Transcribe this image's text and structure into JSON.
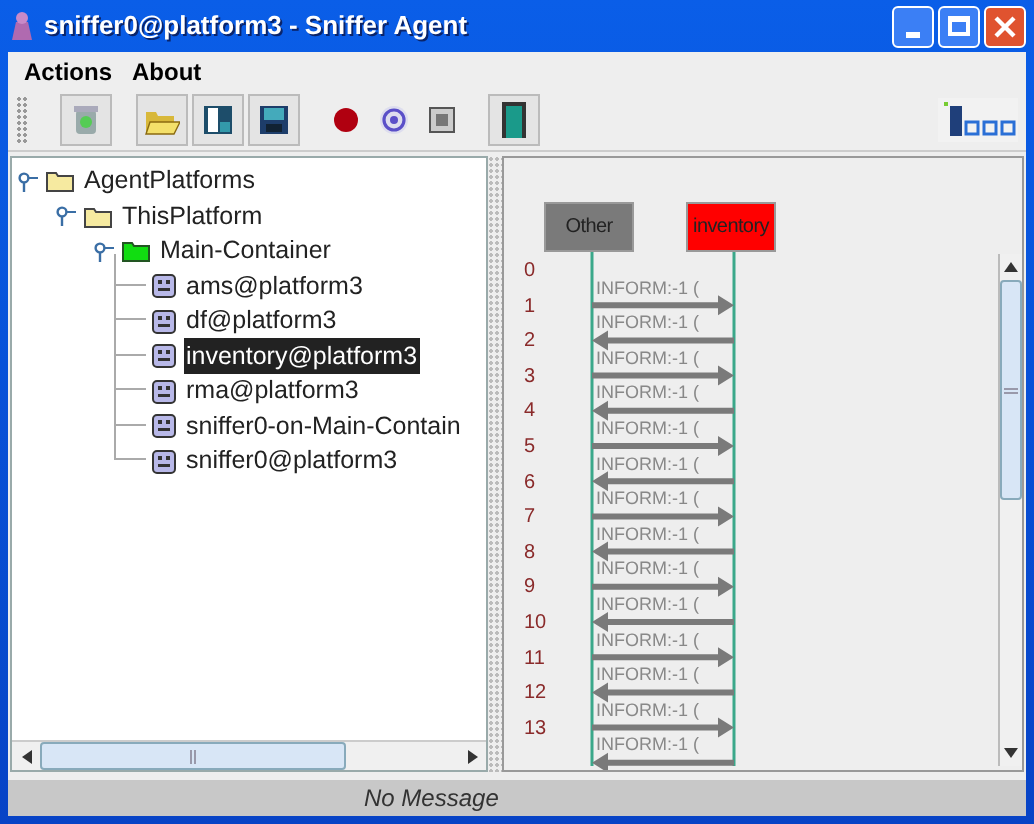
{
  "window": {
    "title": "sniffer0@platform3 - Sniffer Agent"
  },
  "menu": [
    "Actions",
    "About"
  ],
  "tree": [
    {
      "label": "AgentPlatforms",
      "kind": "folder",
      "expanded": true,
      "selected": false,
      "children": [
        {
          "label": "ThisPlatform",
          "kind": "folder",
          "expanded": true,
          "selected": false,
          "children": [
            {
              "label": "Main-Container",
              "kind": "container",
              "expanded": true,
              "selected": false,
              "children": [
                {
                  "label": "ams@platform3",
                  "kind": "agent",
                  "selected": false
                },
                {
                  "label": "df@platform3",
                  "kind": "agent",
                  "selected": false
                },
                {
                  "label": "inventory@platform3",
                  "kind": "agent",
                  "selected": true
                },
                {
                  "label": "rma@platform3",
                  "kind": "agent",
                  "selected": false
                },
                {
                  "label": "sniffer0-on-Main-Contain",
                  "kind": "agent",
                  "selected": false
                },
                {
                  "label": "sniffer0@platform3",
                  "kind": "agent",
                  "selected": false
                }
              ]
            }
          ]
        }
      ]
    }
  ],
  "agents": [
    {
      "label": "Other",
      "color": "#7a7a7a"
    },
    {
      "label": "inventory",
      "color": "#ff0000"
    }
  ],
  "row_numbers": [
    "0",
    "1",
    "2",
    "3",
    "4",
    "5",
    "6",
    "7",
    "8",
    "9",
    "10",
    "11",
    "12",
    "13"
  ],
  "messages": [
    {
      "label": "INFORM:-1 (",
      "kind": "rightward"
    },
    {
      "label": "INFORM:-1 (",
      "kind": "leftward"
    },
    {
      "label": "INFORM:-1 (",
      "kind": "rightward"
    },
    {
      "label": "INFORM:-1 (",
      "kind": "leftward"
    },
    {
      "label": "INFORM:-1 (",
      "kind": "rightward"
    },
    {
      "label": "INFORM:-1 (",
      "kind": "leftward"
    },
    {
      "label": "INFORM:-1 (",
      "kind": "rightward"
    },
    {
      "label": "INFORM:-1 (",
      "kind": "leftward"
    },
    {
      "label": "INFORM:-1 (",
      "kind": "rightward"
    },
    {
      "label": "INFORM:-1 (",
      "kind": "leftward"
    },
    {
      "label": "INFORM:-1 (",
      "kind": "rightward"
    },
    {
      "label": "INFORM:-1 (",
      "kind": "leftward"
    },
    {
      "label": "INFORM:-1 (",
      "kind": "rightward"
    },
    {
      "label": "INFORM:-1 (",
      "kind": "leftward"
    }
  ],
  "status_bar": "No Message"
}
